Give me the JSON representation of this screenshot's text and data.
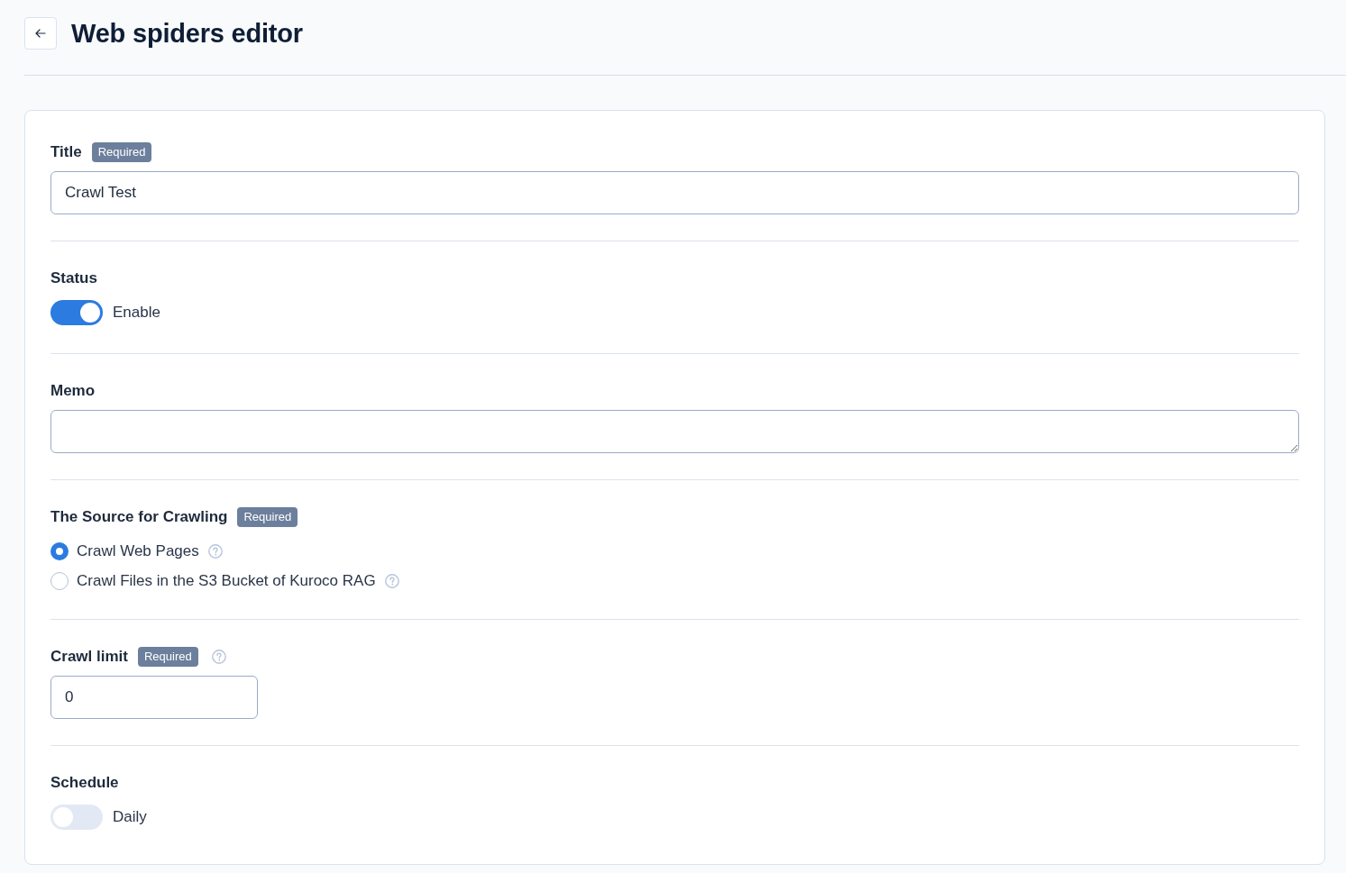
{
  "header": {
    "title": "Web spiders editor"
  },
  "form": {
    "fields": [
      {
        "kind": "text",
        "label": "Title",
        "required_badge": "Required",
        "value": "Crawl Test"
      },
      {
        "kind": "toggle",
        "label": "Status",
        "on": true,
        "option": "Enable"
      },
      {
        "kind": "textarea",
        "label": "Memo"
      },
      {
        "kind": "radio",
        "label": "The Source for Crawling",
        "required_badge": "Required",
        "options": [
          {
            "label": "Crawl Web Pages",
            "selected": true,
            "help": true
          },
          {
            "label": "Crawl Files in the S3 Bucket of Kuroco RAG",
            "selected": false,
            "help": true
          }
        ]
      },
      {
        "kind": "number",
        "label": "Crawl limit",
        "required_badge": "Required",
        "help": true,
        "value": "0"
      },
      {
        "kind": "toggle",
        "label": "Schedule",
        "on": false,
        "option": "Daily"
      }
    ]
  }
}
